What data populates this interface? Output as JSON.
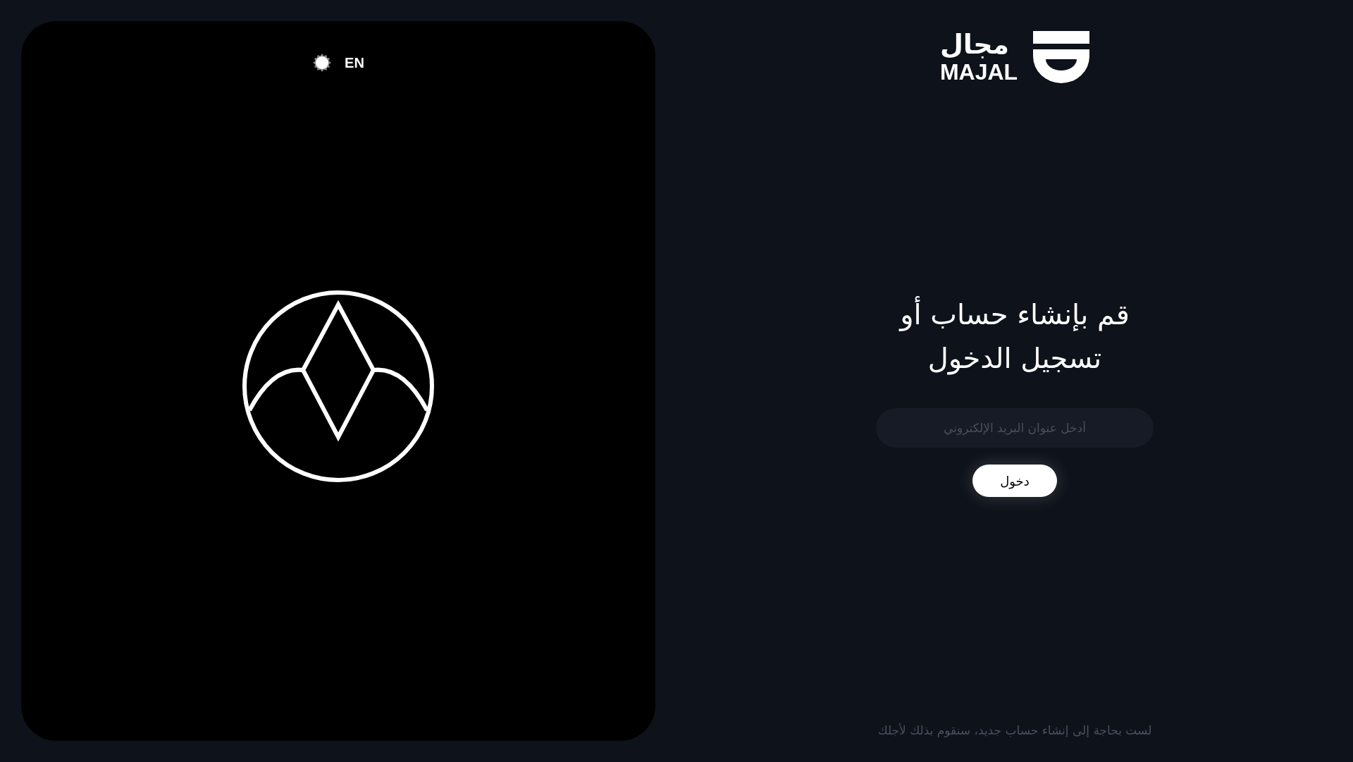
{
  "language_toggle": {
    "label": "EN"
  },
  "logo": {
    "arabic_name": "مجال",
    "latin_name": "MAJAL"
  },
  "login": {
    "title": "قم بإنشاء حساب أو تسجيل الدخول",
    "email_field": {
      "placeholder": "أدخل عنوان البريد الإلكتروني"
    },
    "submit_button": "دخول"
  },
  "footer_note": "لست بحاجة إلى إنشاء حساب جديد، سنقوم بذلك لأجلك"
}
